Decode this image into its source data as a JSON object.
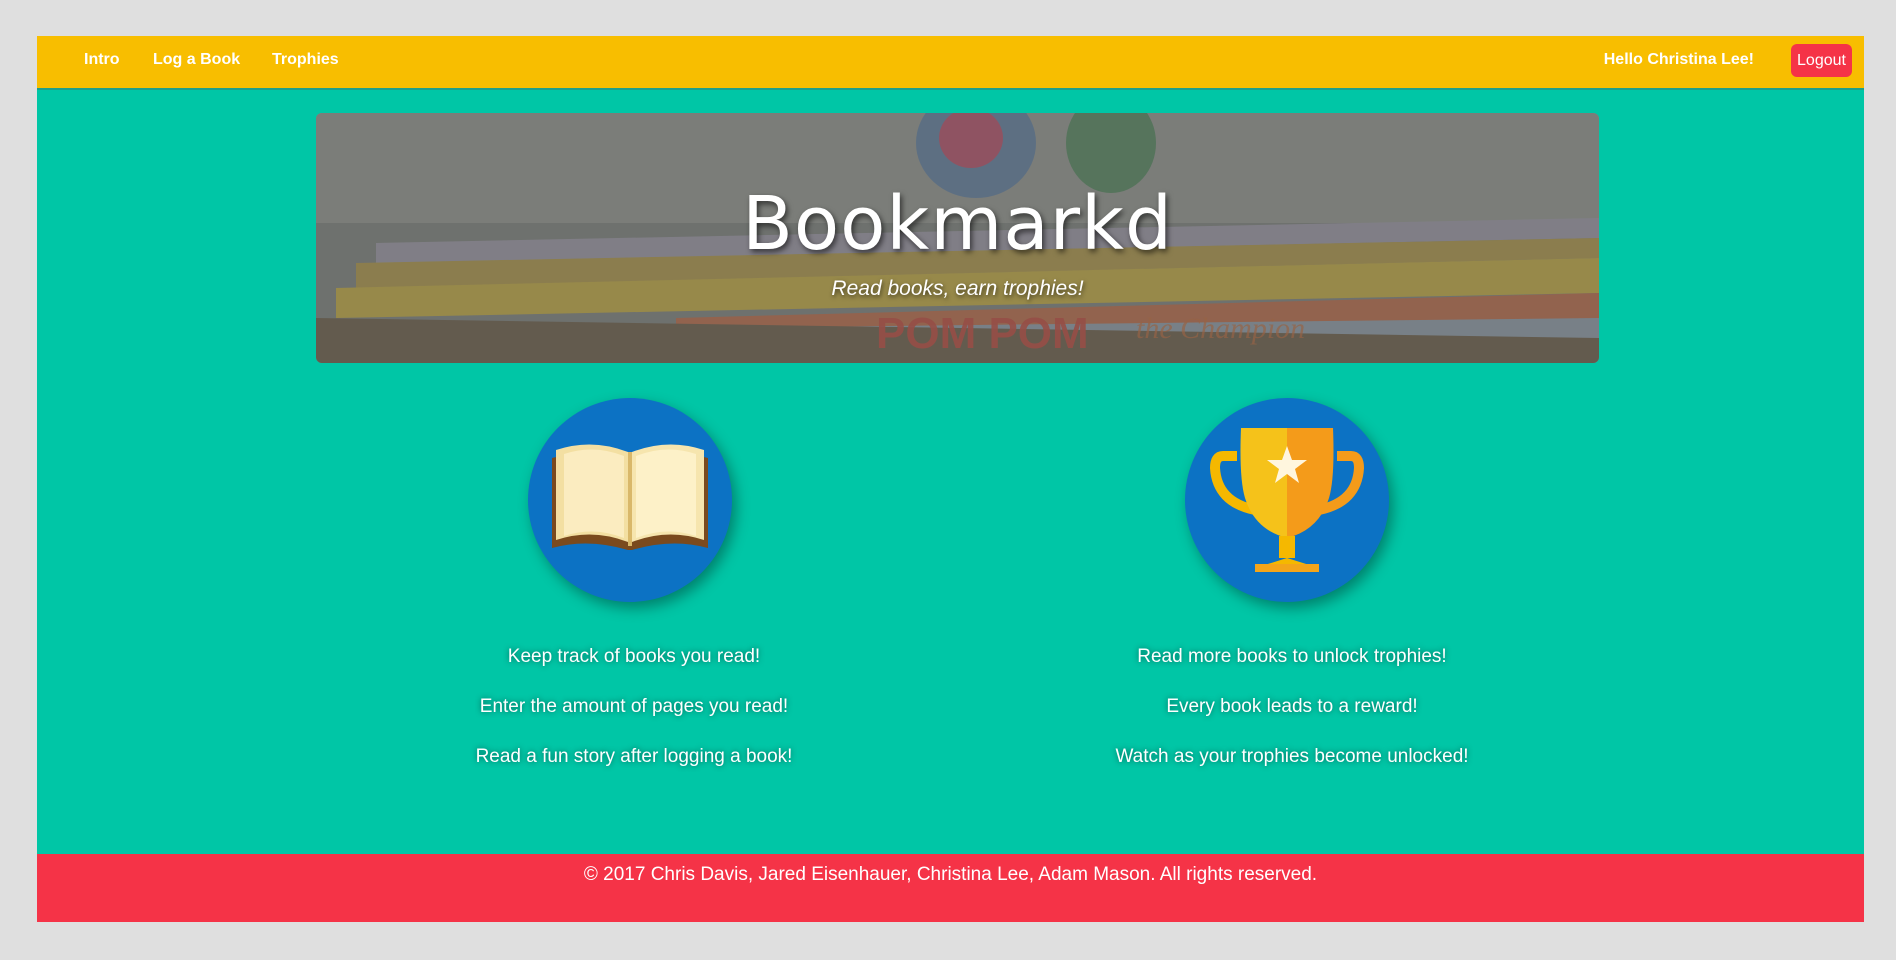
{
  "navbar": {
    "links": [
      "Intro",
      "Log a Book",
      "Trophies"
    ],
    "greeting": "Hello Christina Lee!",
    "logout_label": "Logout"
  },
  "hero": {
    "title": "Bookmarkd",
    "subtitle": "Read books, earn trophies!"
  },
  "features": {
    "left": {
      "icon": "open-book-icon",
      "lines": [
        "Keep track of books you read!",
        "Enter the amount of pages you read!",
        "Read a fun story after logging a book!"
      ]
    },
    "right": {
      "icon": "trophy-icon",
      "lines": [
        "Read more books to unlock trophies!",
        "Every book leads to a reward!",
        "Watch as your trophies become unlocked!"
      ]
    }
  },
  "footer": {
    "text": "© 2017 Chris Davis, Jared Eisenhauer, Christina Lee, Adam Mason. All rights reserved."
  },
  "colors": {
    "navbar": "#f8be00",
    "page": "#00c6a6",
    "footer": "#f53347",
    "logout": "#f53347",
    "icon_circle": "#0c72c4"
  }
}
